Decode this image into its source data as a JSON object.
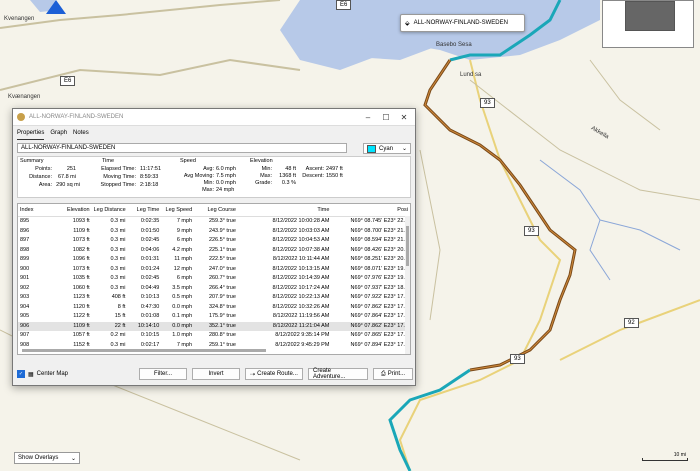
{
  "map": {
    "labels": {
      "kvenangen": "Kvenangen",
      "kvenangen2": "Kvænangen",
      "e6": "E6",
      "e6_top": "E6",
      "basas": "Basebo Sesa",
      "lundsa": "Lund sa",
      "akailla": "Akkeila",
      "road93a": "93",
      "road93b": "93",
      "road92": "92",
      "road93c": "93"
    },
    "tooltip": "ALL-NORWAY-FINLAND-SWEDEN",
    "show_overlays": "Show Overlays",
    "scale_label": "10 mi",
    "route_color": "#1aa7b8",
    "highlight_color": "#7a4a1a"
  },
  "window": {
    "title": "ALL-NORWAY-FINLAND-SWEDEN",
    "tabs": [
      "Properties",
      "Graph",
      "Notes"
    ],
    "name_value": "ALL-NORWAY-FINLAND-SWEDEN",
    "color_value": "Cyan",
    "color_hex": "#00e5ff",
    "summary": {
      "summary_hd": "Summary",
      "points_lab": "Points:",
      "points_val": "251",
      "distance_lab": "Distance:",
      "distance_val": "67.8 mi",
      "area_lab": "Area:",
      "area_val": "290 sq mi",
      "time_hd": "Time",
      "elapsed_lab": "Elapsed Time:",
      "elapsed_val": "11:17:51",
      "moving_lab": "Moving Time:",
      "moving_val": "8:59:33",
      "stopped_lab": "Stopped Time:",
      "stopped_val": "2:18:18",
      "speed_hd": "Speed",
      "avg_lab": "Avg:",
      "avg_val": "6.0 mph",
      "avgmov_lab": "Avg Moving:",
      "avgmov_val": "7.5 mph",
      "min_lab": "Min:",
      "min_val": "0.0 mph",
      "max_lab": "Max:",
      "max_val": "24 mph",
      "elev_hd": "Elevation",
      "emin_lab": "Min:",
      "emin_val": "48 ft",
      "emax_lab": "Max:",
      "emax_val": "1368 ft",
      "grade_lab": "Grade:",
      "grade_val": "0.3 %",
      "ascent_lab": "Ascent:",
      "ascent_val": "2497 ft",
      "descent_lab": "Descent:",
      "descent_val": "1550 ft"
    },
    "table": {
      "headers": [
        "Index",
        "Elevation",
        "Leg Distance",
        "Leg Time",
        "Leg Speed",
        "Leg Course",
        "Time",
        "Posi"
      ],
      "rows": [
        [
          "895",
          "1093 ft",
          "0.3 mi",
          "0:02:35",
          "7 mph",
          "259.3° true",
          "8/12/2022 10:00:28 AM",
          "N69° 08.745' E23° 22.4"
        ],
        [
          "896",
          "1109 ft",
          "0.3 mi",
          "0:01:50",
          "9 mph",
          "243.9° true",
          "8/12/2022 10:03:03 AM",
          "N69° 08.700' E23° 21.7"
        ],
        [
          "897",
          "1073 ft",
          "0.3 mi",
          "0:02:45",
          "6 mph",
          "226.5° true",
          "8/12/2022 10:04:53 AM",
          "N69° 08.594' E23° 21.1"
        ],
        [
          "898",
          "1082 ft",
          "0.3 mi",
          "0:04:06",
          "4.2 mph",
          "225.1° true",
          "8/12/2022 10:07:38 AM",
          "N69° 08.426' E23° 20.6"
        ],
        [
          "899",
          "1096 ft",
          "0.3 mi",
          "0:01:31",
          "11 mph",
          "222.5° true",
          "8/12/2022 10:11:44 AM",
          "N69° 08.251' E23° 20.0"
        ],
        [
          "900",
          "1073 ft",
          "0.3 mi",
          "0:01:24",
          "12 mph",
          "247.0° true",
          "8/12/2022 10:13:15 AM",
          "N69° 08.071' E23° 19.6"
        ],
        [
          "901",
          "1035 ft",
          "0.3 mi",
          "0:02:45",
          "6 mph",
          "260.7° true",
          "8/12/2022 10:14:39 AM",
          "N69° 07.976' E23° 19.0"
        ],
        [
          "902",
          "1060 ft",
          "0.3 mi",
          "0:04:49",
          "3.5 mph",
          "266.4° true",
          "8/12/2022 10:17:24 AM",
          "N69° 07.937' E23° 18.4"
        ],
        [
          "903",
          "1123 ft",
          "408 ft",
          "0:10:13",
          "0.5 mph",
          "207.9° true",
          "8/12/2022 10:22:13 AM",
          "N69° 07.922' E23° 17.7"
        ],
        [
          "904",
          "1120 ft",
          "8 ft",
          "0:47:30",
          "0.0 mph",
          "324.8° true",
          "8/12/2022 10:32:26 AM",
          "N69° 07.862' E23° 17.6"
        ],
        [
          "905",
          "1122 ft",
          "15 ft",
          "0:01:08",
          "0.1 mph",
          "175.9° true",
          "8/12/2022 11:19:56 AM",
          "N69° 07.864' E23° 17.6"
        ],
        [
          "906",
          "1109 ft",
          "22 ft",
          "10:14:10",
          "0.0 mph",
          "352.1° true",
          "8/12/2022 11:21:04 AM",
          "N69° 07.862' E23° 17.6"
        ],
        [
          "907",
          "1057 ft",
          "0.2 mi",
          "0:10:15",
          "1.0 mph",
          "280.8° true",
          "8/12/2022 9:35:14 PM",
          "N69° 07.865' E23° 17.6"
        ],
        [
          "908",
          "1152 ft",
          "0.3 mi",
          "0:02:17",
          "7 mph",
          "259.1° true",
          "8/12/2022 9:45:29 PM",
          "N69° 07.894' E23° 17.2"
        ]
      ]
    },
    "bottom": {
      "center_map": "Center Map",
      "filter": "Filter...",
      "invert": "Invert",
      "create_route": "Create Route...",
      "create_adventure": "Create Adventure...",
      "print": "Print..."
    }
  }
}
